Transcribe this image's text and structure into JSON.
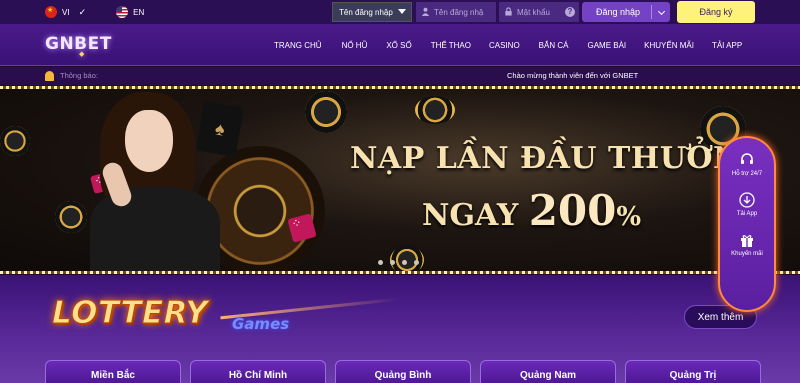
{
  "topbar": {
    "lang_vi": "VI",
    "lang_en": "EN",
    "login_select": "Tên đăng nhập",
    "username_placeholder": "Tên đăng nhậ",
    "password_placeholder": "Mật khẩu",
    "help": "?",
    "login_button": "Đăng nhập",
    "register_button": "Đăng ký"
  },
  "nav": {
    "logo": "GNBET",
    "items": [
      "TRANG CHỦ",
      "NỔ HŨ",
      "XỔ SỐ",
      "THỂ THAO",
      "CASINO",
      "BẮN CÁ",
      "GAME BÀI",
      "KHUYẾN MÃI",
      "TẢI APP"
    ]
  },
  "notice": {
    "label": "Thông báo:",
    "text": "Chào mừng thành viên đến với GNBET"
  },
  "banner": {
    "line1": "NẠP LẦN ĐẦU THƯỞNG",
    "line2_prefix": "NGAY",
    "line2_amount": "200",
    "line2_pct": "%"
  },
  "side_panel": {
    "support": "Hỗ trợ 24/7",
    "download": "Tải App",
    "promo": "Khuyến mãi"
  },
  "section": {
    "title": "LOTTERY",
    "subtitle": "Games",
    "more_button": "Xem thêm",
    "tabs": [
      "Miền Bắc",
      "Hồ Chí Minh",
      "Quảng Bình",
      "Quảng Nam",
      "Quảng Trị"
    ]
  },
  "colors": {
    "accent": "#7442c4",
    "register": "#fff27a",
    "panel_glow": "#ff8a3d"
  }
}
